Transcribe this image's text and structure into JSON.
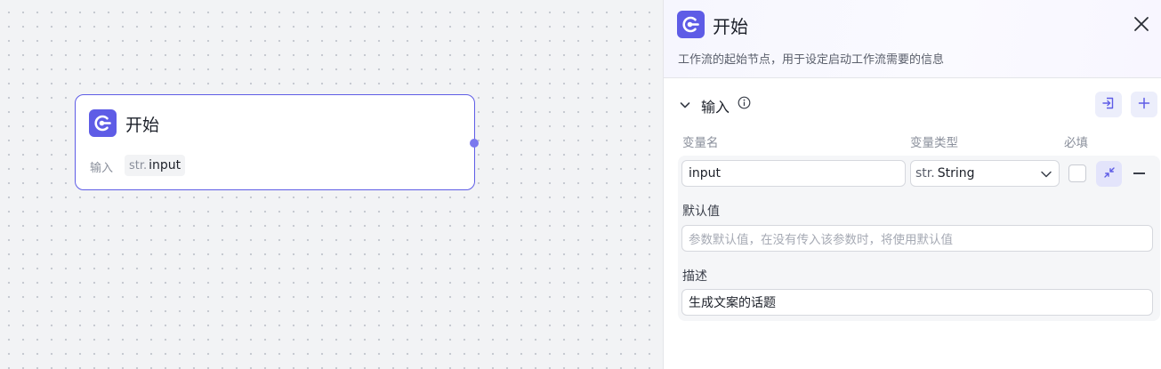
{
  "canvas": {
    "node": {
      "title": "开始",
      "input_label": "输入",
      "input_type": "str.",
      "input_name": "input"
    }
  },
  "panel": {
    "title": "开始",
    "description": "工作流的起始节点，用于设定启动工作流需要的信息",
    "section": {
      "title": "输入",
      "columns": {
        "name": "变量名",
        "type": "变量类型",
        "required": "必填"
      }
    },
    "variable": {
      "name": "input",
      "type_prefix": "str.",
      "type_label": "String",
      "default_label": "默认值",
      "default_placeholder": "参数默认值，在没有传入该参数时，将使用默认值",
      "desc_label": "描述",
      "desc_value": "生成文案的话题"
    }
  },
  "colors": {
    "accent": "#5e5ce6",
    "border": "#d6d8de",
    "canvas": "#f2f3f5"
  },
  "icons": [
    "start-node-icon",
    "close-icon",
    "chevron-down-icon",
    "info-icon",
    "import-icon",
    "plus-icon",
    "collapse-icon",
    "minus-icon"
  ]
}
